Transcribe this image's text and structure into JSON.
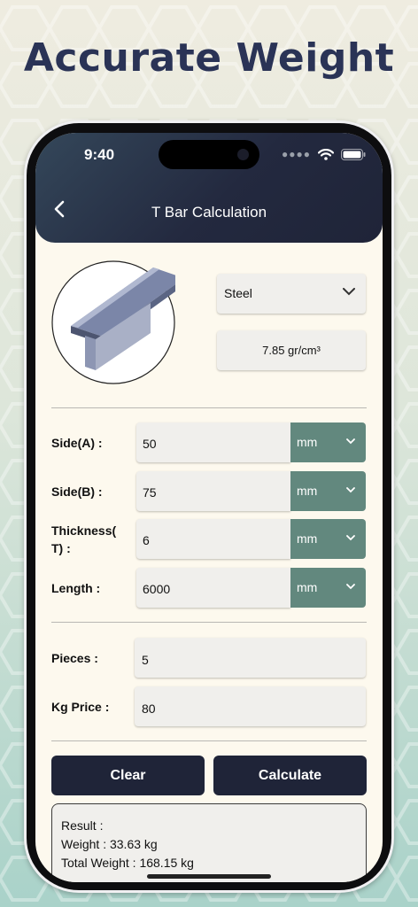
{
  "headline": "Accurate Weight",
  "status_bar": {
    "time": "9:40"
  },
  "header": {
    "title": "T Bar Calculation"
  },
  "material": {
    "selected": "Steel",
    "density": "7.85 gr/cm³"
  },
  "dimensions": [
    {
      "label": "Side(A) :",
      "value": "50",
      "unit": "mm"
    },
    {
      "label": "Side(B) :",
      "value": "75",
      "unit": "mm"
    },
    {
      "label_line1": "Thickness(",
      "label_line2": "T) :",
      "value": "6",
      "unit": "mm"
    },
    {
      "label": "Length :",
      "value": "6000",
      "unit": "mm"
    }
  ],
  "pieces": {
    "label": "Pieces :",
    "value": "5"
  },
  "kg_price": {
    "label": "Kg Price :",
    "value": "80"
  },
  "buttons": {
    "clear": "Clear",
    "calculate": "Calculate"
  },
  "result": {
    "title": "Result :",
    "weight": "Weight : 33.63 kg",
    "total_weight": "Total Weight : 168.15 kg"
  },
  "colors": {
    "header": "#23293f",
    "unit_bg": "#62887e",
    "button": "#1f2438",
    "headline": "#2a3356"
  }
}
